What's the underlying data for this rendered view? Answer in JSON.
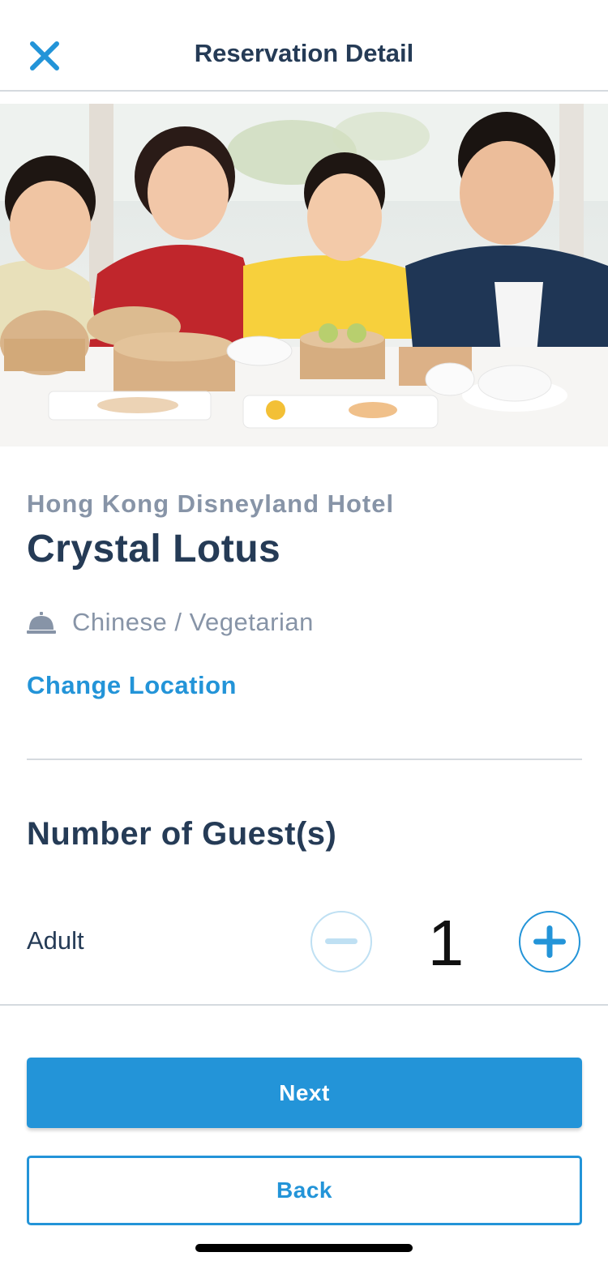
{
  "header": {
    "title": "Reservation Detail",
    "close_icon": "close-icon"
  },
  "hero": {
    "image_icon": "family-dining-photo"
  },
  "restaurant": {
    "hotel": "Hong Kong Disneyland Hotel",
    "name": "Crystal Lotus",
    "cuisine": "Chinese / Vegetarian",
    "cuisine_icon": "service-bell-icon",
    "change_location": "Change Location"
  },
  "guests": {
    "title": "Number of Guest(s)",
    "adult_label": "Adult",
    "adult_count": "1",
    "decrement_icon": "minus-icon",
    "increment_icon": "plus-icon"
  },
  "actions": {
    "next_label": "Next",
    "back_label": "Back"
  },
  "colors": {
    "accent": "#2394d8",
    "title": "#253b56",
    "muted": "#8794a7",
    "divider": "#d5dadf",
    "disabled_border": "#bfe0f3"
  }
}
